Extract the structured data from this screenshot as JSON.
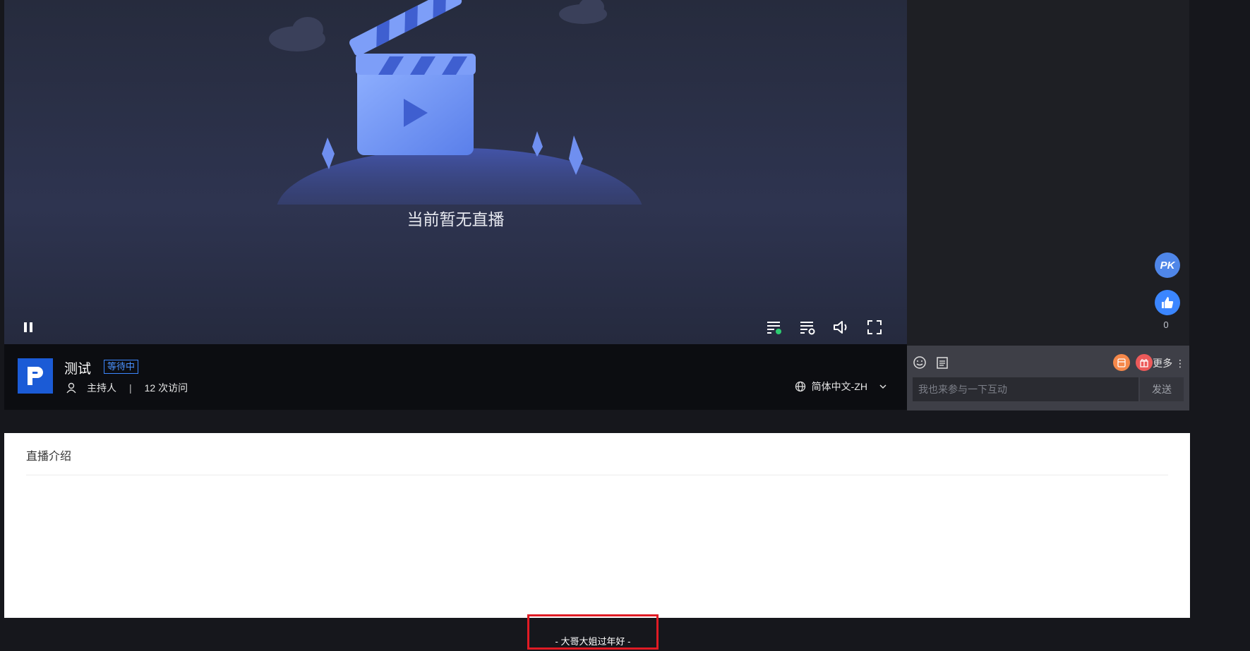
{
  "player": {
    "empty_message": "当前暂无直播"
  },
  "room": {
    "title": "测试",
    "status": "等待中",
    "host_label": "主持人",
    "visits": "12 次访问",
    "separator": "|",
    "language": "简体中文-ZH"
  },
  "side": {
    "pk_label": "PK",
    "like_count": "0"
  },
  "chat": {
    "placeholder": "我也来参与一下互动",
    "send_label": "发送",
    "more_label": "更多"
  },
  "intro": {
    "title": "直播介绍"
  },
  "footer": {
    "text": "- 大哥大姐过年好 -"
  },
  "colors": {
    "accent": "#3b86ff",
    "logo_bg": "#1b5bd6",
    "highlight_border": "#e01b24"
  }
}
